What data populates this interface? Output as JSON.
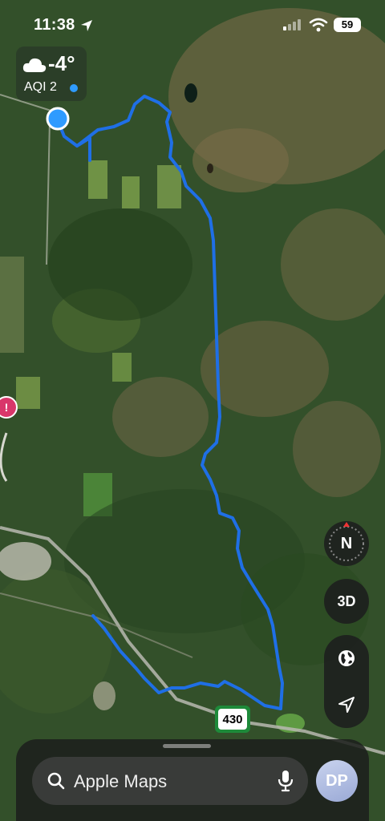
{
  "status_bar": {
    "time": "11:38",
    "battery": "59"
  },
  "weather": {
    "temperature": "-4°",
    "aqi": "AQI 2"
  },
  "map_controls": {
    "compass_label": "N",
    "view_3d_label": "3D"
  },
  "route_shield": {
    "number": "430"
  },
  "search": {
    "placeholder": "Apple Maps"
  },
  "profile": {
    "initials": "DP"
  },
  "colors": {
    "route": "#1f6fe6",
    "location": "#2f9bff",
    "shield": "#1e8a3a"
  }
}
